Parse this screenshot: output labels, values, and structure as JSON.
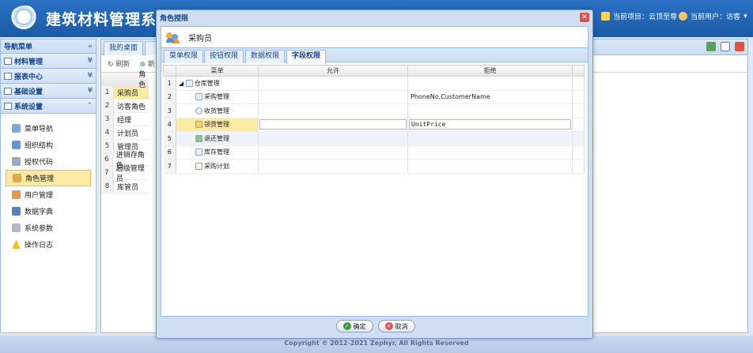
{
  "app": {
    "title": "建筑材料管理系",
    "project": "当前项目：云顶至尊",
    "user": "当前用户：访客"
  },
  "nav": {
    "title": "导航菜单",
    "groups": [
      "材料管理",
      "报表中心",
      "基础设置",
      "系统设置"
    ],
    "items": [
      "菜单导航",
      "组织结构",
      "授权代码",
      "角色管理",
      "用户管理",
      "数据字典",
      "系统参数",
      "操作日志"
    ]
  },
  "main": {
    "tab1": "我的桌面",
    "tab2": "",
    "refresh": "刷新",
    "add": "新",
    "col": "角色",
    "rows": [
      "采购员",
      "访客角色",
      "经理",
      "计划员",
      "管理员",
      "进销存角色",
      "超级管理员",
      "库管员"
    ]
  },
  "dialog": {
    "title": "角色授限",
    "role": "采购员",
    "tabs": [
      "菜单权限",
      "按钮权限",
      "数据权限",
      "字段权限"
    ],
    "headers": [
      "菜单",
      "允许",
      "拒绝"
    ],
    "rows": [
      {
        "n": "1",
        "menu": "仓库管理",
        "allow": "",
        "deny": ""
      },
      {
        "n": "2",
        "menu": "采购管理",
        "allow": "",
        "deny": "PhoneNo,CustomerName"
      },
      {
        "n": "3",
        "menu": "收货管理",
        "allow": "",
        "deny": ""
      },
      {
        "n": "4",
        "menu": "领货管理",
        "allow": "",
        "deny": "UnitPrice"
      },
      {
        "n": "5",
        "menu": "退还管理",
        "allow": "",
        "deny": ""
      },
      {
        "n": "6",
        "menu": "库存管理",
        "allow": "",
        "deny": ""
      },
      {
        "n": "7",
        "menu": "采购计划",
        "allow": "",
        "deny": ""
      }
    ],
    "ok": "确定",
    "cancel": "取消"
  },
  "footer": "Copyright © 2012-2021 Zephyr, All Rights Reserved"
}
